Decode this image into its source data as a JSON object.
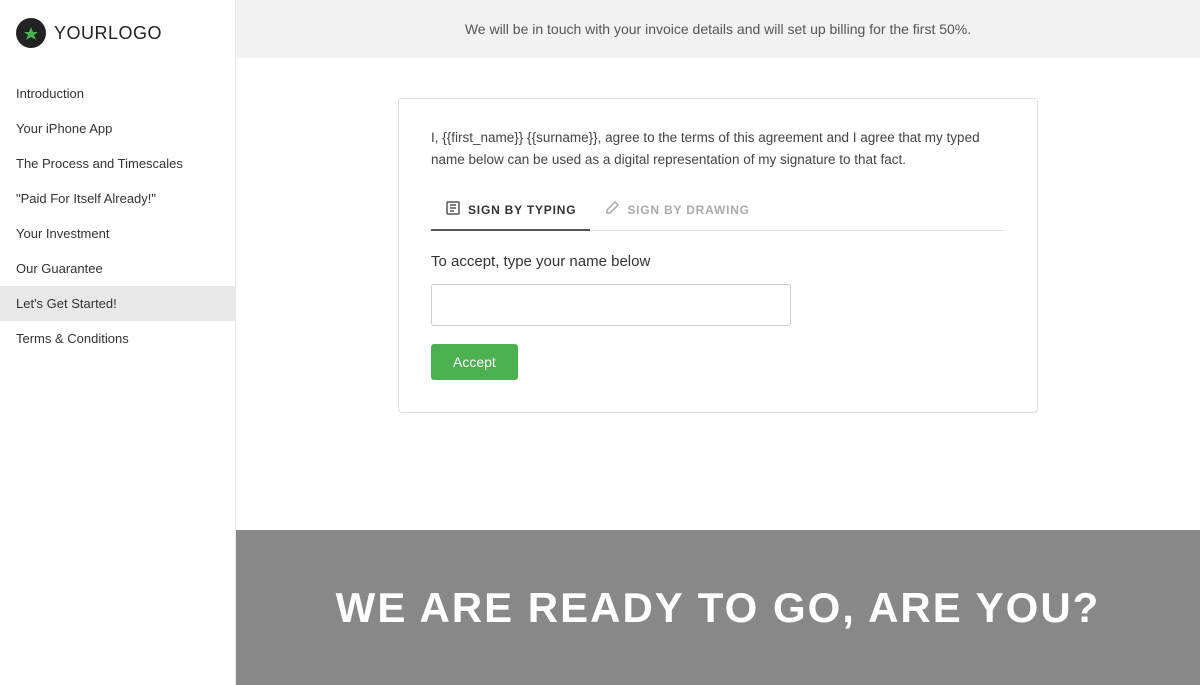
{
  "logo": {
    "text_bold": "YOUR",
    "text_light": "LOGO"
  },
  "sidebar": {
    "items": [
      {
        "label": "Introduction",
        "active": false
      },
      {
        "label": "Your iPhone App",
        "active": false
      },
      {
        "label": "The Process and Timescales",
        "active": false
      },
      {
        "label": "\"Paid For Itself Already!\"",
        "active": false
      },
      {
        "label": "Your Investment",
        "active": false
      },
      {
        "label": "Our Guarantee",
        "active": false
      },
      {
        "label": "Let's Get Started!",
        "active": true
      },
      {
        "label": "Terms & Conditions",
        "active": false
      }
    ]
  },
  "top_banner": {
    "text": "We will be in touch with your invoice details and will set up billing for the first 50%."
  },
  "signature_section": {
    "agreement_text": "I, {{first_name}} {{surname}}, agree to the terms of this agreement and I agree that my typed name below can be used as a digital representation of my signature to that fact.",
    "tabs": [
      {
        "label": "SIGN BY TYPING",
        "active": true
      },
      {
        "label": "SIGN BY DRAWING",
        "active": false
      }
    ],
    "type_name_label": "To accept, type your name below",
    "name_input_placeholder": "",
    "accept_button_label": "Accept"
  },
  "footer": {
    "text": "WE ARE READY TO GO, ARE YOU?"
  }
}
